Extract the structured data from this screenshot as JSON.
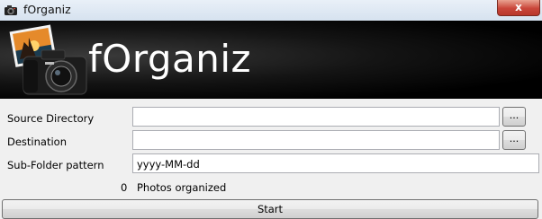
{
  "window": {
    "title": "fOrganiz",
    "close_label": "x"
  },
  "banner": {
    "title": "fOrganiz"
  },
  "form": {
    "source": {
      "label": "Source Directory",
      "value": "",
      "browse_label": "..."
    },
    "destination": {
      "label": "Destination",
      "value": "",
      "browse_label": "..."
    },
    "pattern": {
      "label": "Sub-Folder pattern",
      "value": "yyyy-MM-dd"
    }
  },
  "status": {
    "count": "0",
    "text": "Photos organized"
  },
  "actions": {
    "start_label": "Start"
  },
  "icons": {
    "app": "camera-icon",
    "logo": "camera-with-photo-logo"
  }
}
